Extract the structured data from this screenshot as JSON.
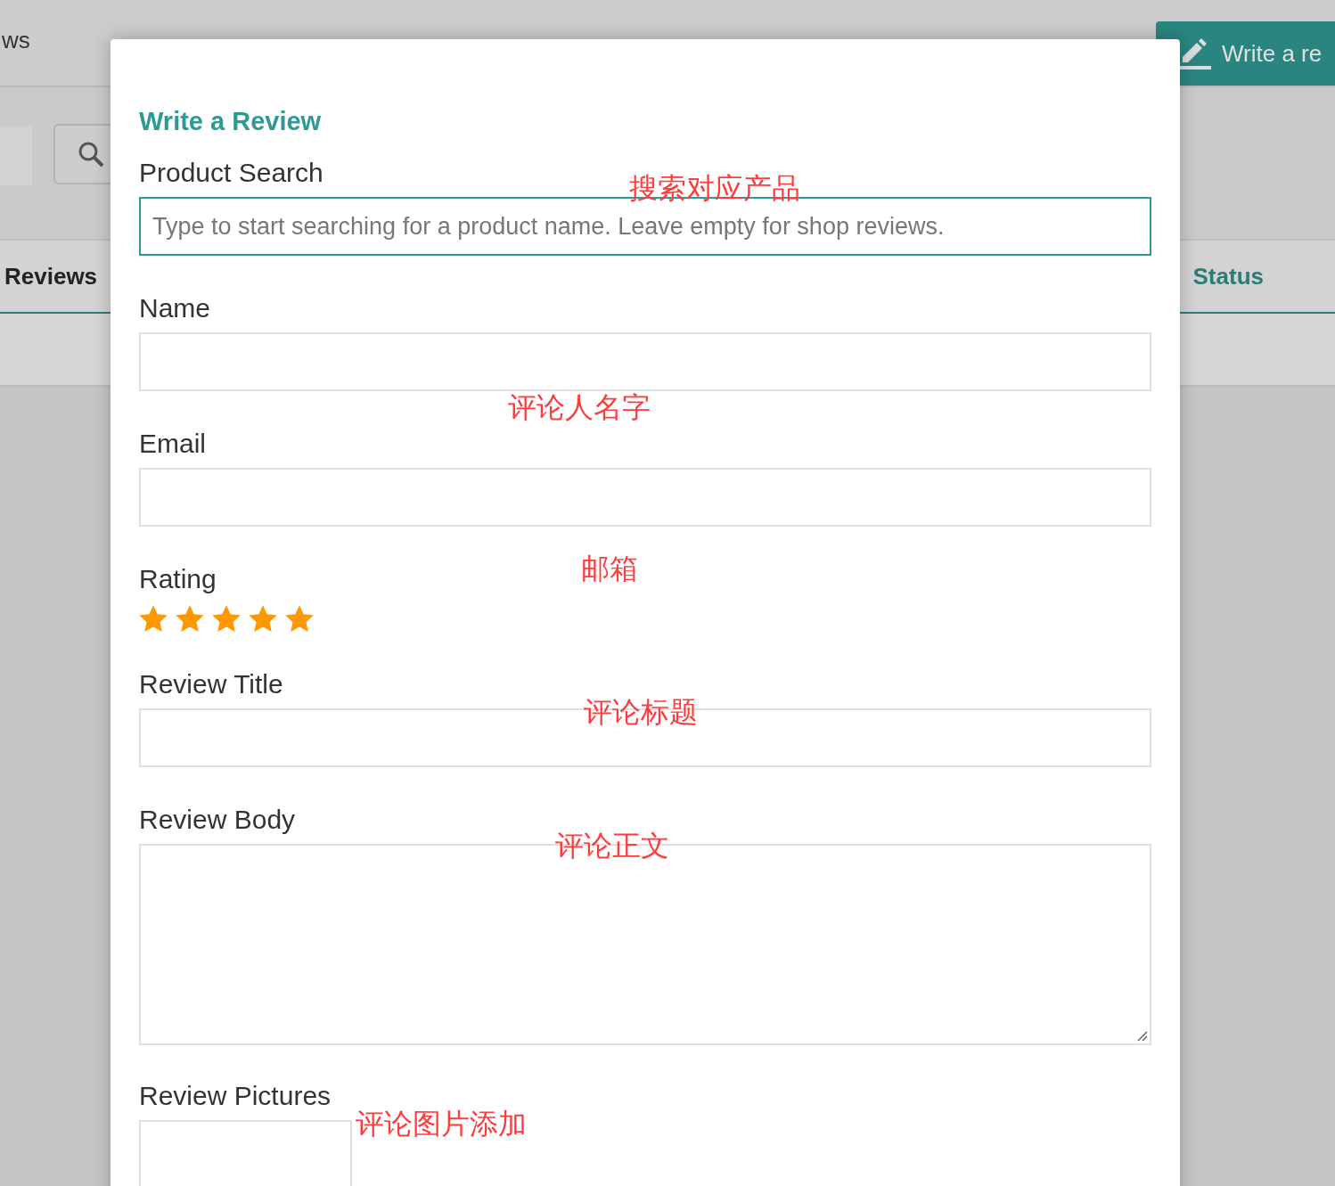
{
  "background": {
    "tabs": [
      {
        "label": "ws"
      }
    ],
    "write_button": {
      "label": "Write a re"
    },
    "table": {
      "columns": [
        "Reviews",
        "Status"
      ]
    }
  },
  "dialog": {
    "title": "Write a Review",
    "fields": [
      {
        "kind": "text",
        "label": "Product Search",
        "placeholder": "Type to start searching for a product name. Leave empty for shop reviews.",
        "focused": true
      },
      {
        "kind": "text",
        "label": "Name",
        "focused": false
      },
      {
        "kind": "text",
        "label": "Email",
        "focused": false
      },
      {
        "kind": "rating",
        "label": "Rating",
        "stars": 5
      },
      {
        "kind": "text",
        "label": "Review Title",
        "focused": false
      },
      {
        "kind": "textarea",
        "label": "Review Body"
      },
      {
        "kind": "upload",
        "label": "Review Pictures"
      }
    ],
    "annotations": [
      "搜索对应产品",
      "评论人名字",
      "邮箱",
      "评论标题",
      "评论正文",
      "评论图片添加"
    ]
  }
}
